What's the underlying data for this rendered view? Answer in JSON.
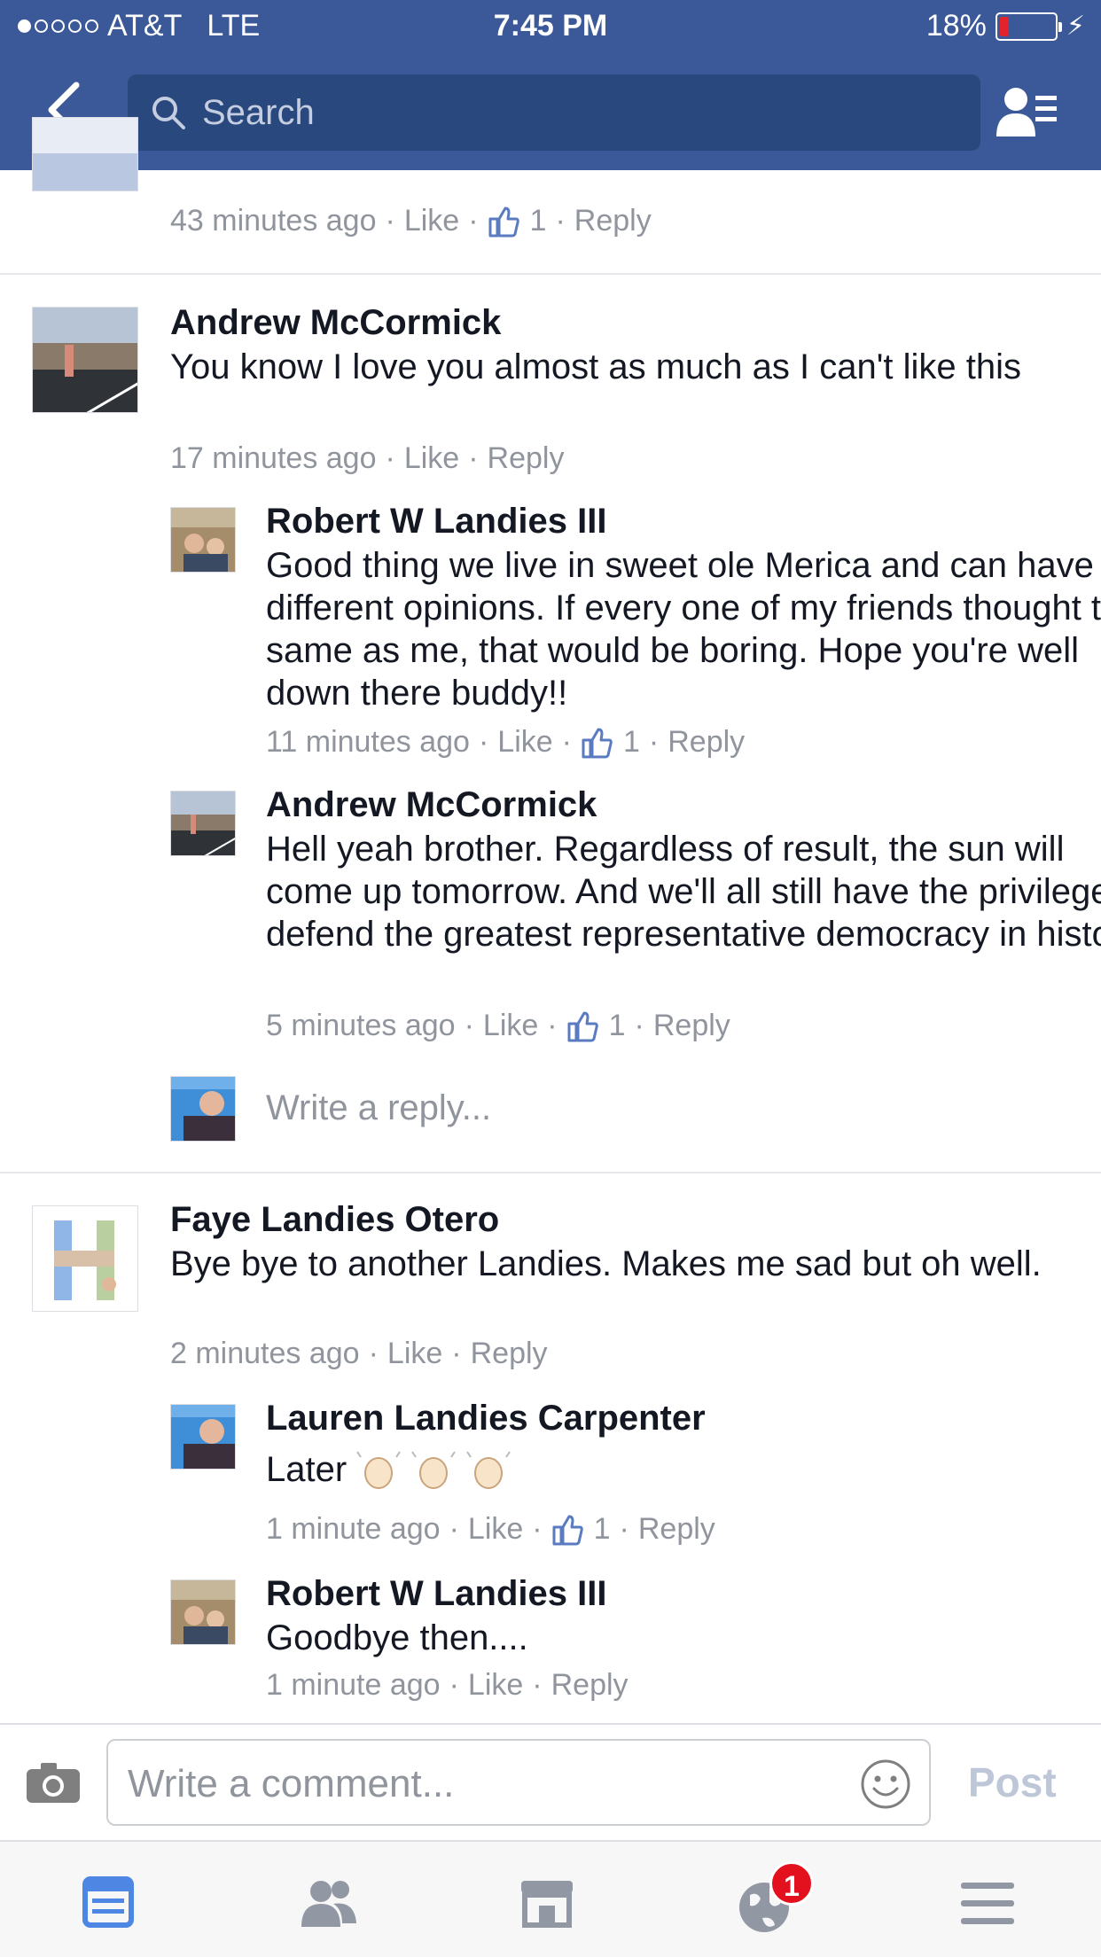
{
  "status_bar": {
    "carrier": "AT&T",
    "network": "LTE",
    "time": "7:45 PM",
    "battery": "18%",
    "battery_level": 0.18
  },
  "header": {
    "search_placeholder": "Search",
    "icons": [
      "back-chevron-icon",
      "search-icon",
      "friend-requests-icon"
    ],
    "bar_color": "#3b5998"
  },
  "comments": [
    {
      "id": "c0",
      "meta": {
        "time": "43 minutes ago",
        "like": "Like",
        "likes": "1",
        "reply": "Reply"
      }
    },
    {
      "id": "c1",
      "author": "Andrew McCormick",
      "text": "You know I love you almost as much as I can't like this",
      "meta": {
        "time": "17 minutes ago",
        "like": "Like",
        "reply": "Reply"
      },
      "replies": [
        {
          "author": "Robert W Landies III",
          "text": "Good thing we live in sweet ole Merica and can have different opinions. If every one of my friends thought the same as me, that would be boring. Hope you're well down there buddy!!",
          "meta": {
            "time": "11 minutes ago",
            "like": "Like",
            "likes": "1",
            "reply": "Reply"
          }
        },
        {
          "author": "Andrew McCormick",
          "text": "Hell yeah brother. Regardless of result, the sun will come up tomorrow. And we'll all still have the privilege to defend the greatest representative democracy in history",
          "meta": {
            "time": "5 minutes ago",
            "like": "Like",
            "likes": "1",
            "reply": "Reply"
          }
        }
      ],
      "write_reply": "Write a reply..."
    },
    {
      "id": "c2",
      "author": "Faye Landies Otero",
      "text": "Bye bye to another Landies.  Makes me sad but oh well.",
      "meta": {
        "time": "2 minutes ago",
        "like": "Like",
        "reply": "Reply"
      },
      "replies": [
        {
          "author": "Lauren Landies Carpenter",
          "text": "Later",
          "emoji": [
            "waving-hand-icon",
            "waving-hand-icon",
            "waving-hand-icon"
          ],
          "meta": {
            "time": "1 minute ago",
            "like": "Like",
            "likes": "1",
            "reply": "Reply"
          }
        },
        {
          "author": "Robert W Landies III",
          "text": "Goodbye then....",
          "meta": {
            "time": "1 minute ago",
            "like": "Like",
            "reply": "Reply"
          }
        }
      ]
    }
  ],
  "composer": {
    "placeholder": "Write a comment...",
    "post_label": "Post",
    "icons": [
      "camera-icon",
      "smiley-icon"
    ]
  },
  "tab_bar": {
    "tabs": [
      "news-feed-icon",
      "friends-icon",
      "marketplace-icon",
      "notifications-globe-icon",
      "menu-icon"
    ],
    "active": "news-feed-icon",
    "notification_badge": "1"
  }
}
